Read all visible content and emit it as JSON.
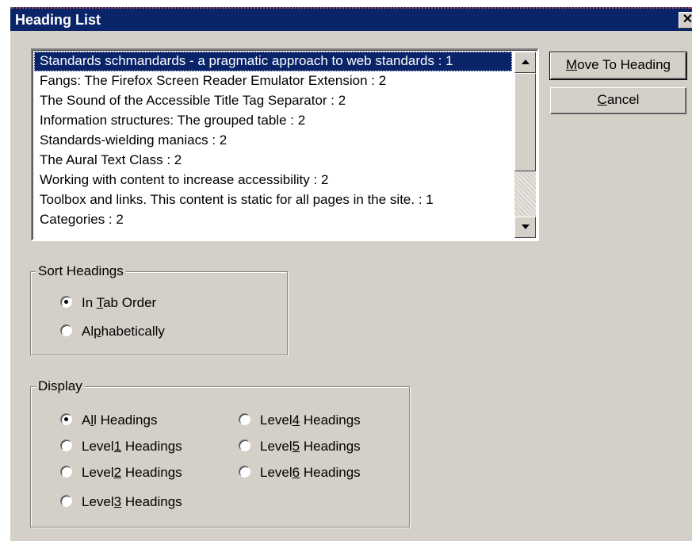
{
  "window": {
    "title": "Heading List",
    "close_glyph": "✕"
  },
  "list": {
    "items": [
      "Standards schmandards - a pragmatic approach to web standards : 1",
      "Fangs: The Firefox Screen Reader Emulator Extension : 2",
      "The Sound of the Accessible Title Tag Separator : 2",
      "Information structures: The grouped table : 2",
      "Standards-wielding maniacs : 2",
      "The Aural Text Class : 2",
      "Working with content to increase accessibility : 2",
      "Toolbox and links. This content is static for all pages in the site. : 1",
      "Categories : 2"
    ],
    "selected_index": 0
  },
  "buttons": {
    "move": {
      "mnemonic": "M",
      "rest": "ove To Heading"
    },
    "cancel": {
      "mnemonic": "C",
      "rest": "ancel"
    }
  },
  "sort": {
    "legend": "Sort Headings",
    "options": [
      {
        "pre": "In ",
        "mnemonic": "T",
        "post": "ab Order",
        "checked": true
      },
      {
        "pre": "Al",
        "mnemonic": "p",
        "post": "habetically",
        "checked": false
      }
    ]
  },
  "display": {
    "legend": "Display",
    "options": [
      {
        "pre": "A",
        "mnemonic": "l",
        "post": "l Headings",
        "checked": true
      },
      {
        "pre": "Level",
        "mnemonic": "1",
        "post": " Headings",
        "checked": false
      },
      {
        "pre": "Level",
        "mnemonic": "2",
        "post": " Headings",
        "checked": false
      },
      {
        "pre": "Level",
        "mnemonic": "3",
        "post": " Headings",
        "checked": false
      },
      {
        "pre": "Level",
        "mnemonic": "4",
        "post": " Headings",
        "checked": false
      },
      {
        "pre": "Level",
        "mnemonic": "5",
        "post": " Headings",
        "checked": false
      },
      {
        "pre": "Level",
        "mnemonic": "6",
        "post": " Headings",
        "checked": false
      }
    ]
  },
  "colors": {
    "titlebar": "#0a246a",
    "selection": "#0a246a",
    "dialog_face": "#d4d0c8"
  }
}
